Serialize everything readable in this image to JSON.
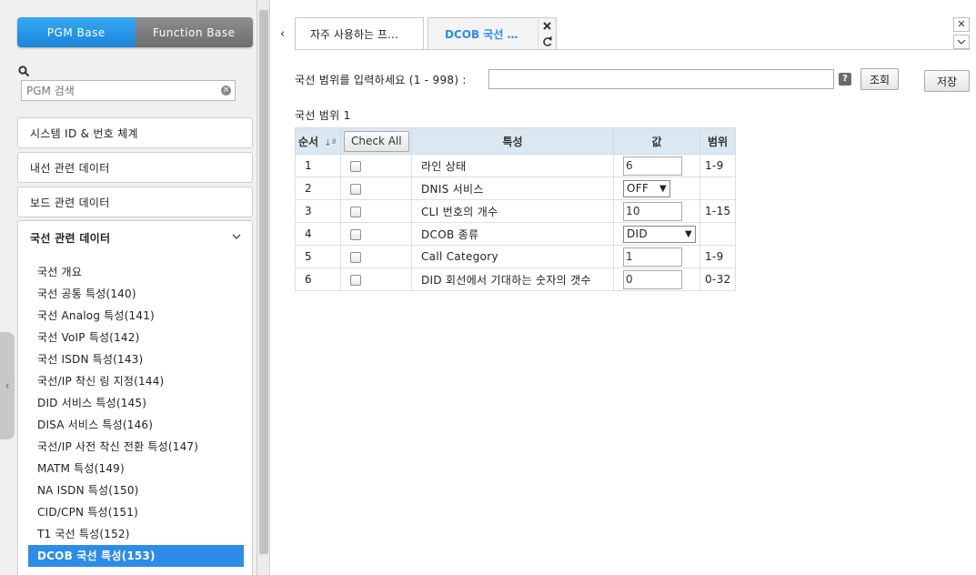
{
  "sidebar": {
    "tabs": [
      "PGM Base",
      "Function Base"
    ],
    "search_placeholder": "PGM 검색",
    "panels": [
      "시스템 ID & 번호 체계",
      "내선 관련 데이터",
      "보드 관련 데이터",
      "국선 관련 데이터"
    ],
    "items": [
      "국선 개요",
      "국선 공통 특성(140)",
      "국선 Analog 특성(141)",
      "국선 VoIP 특성(142)",
      "국선 ISDN 특성(143)",
      "국선/IP 착신 링 지정(144)",
      "DID 서비스 특성(145)",
      "DISA 서비스 특성(146)",
      "국선/IP 사전 착신 전환 특성(147)",
      "MATM 특성(149)",
      "NA ISDN 특성(150)",
      "CID/CPN 특성(151)",
      "T1 국선 특성(152)",
      "DCOB 국선 특성(153)"
    ],
    "active_item": "DCOB 국선 특성(153)"
  },
  "tabs": [
    "자주 사용하는 프…",
    "DCOB 국선 …"
  ],
  "form": {
    "range_label": "국선 범위를 입력하세요 (1 - 998) :",
    "range_value": "",
    "help": "?",
    "search_button": "조회",
    "save_button": "저장",
    "section_title": "국선 범위 1"
  },
  "table": {
    "headers": [
      "순서",
      "Check All",
      "특성",
      "값",
      "범위"
    ],
    "sort_glyph": "↓ª",
    "rows": [
      {
        "no": "1",
        "name": "라인 상태",
        "value": "6",
        "range": "1-9",
        "kind": "input"
      },
      {
        "no": "2",
        "name": "DNIS 서비스",
        "value": "OFF",
        "range": "",
        "kind": "select"
      },
      {
        "no": "3",
        "name": "CLI 번호의 개수",
        "value": "10",
        "range": "1-15",
        "kind": "input"
      },
      {
        "no": "4",
        "name": "DCOB 종류",
        "value": "DID",
        "range": "",
        "kind": "select-wide"
      },
      {
        "no": "5",
        "name": "Call Category",
        "value": "1",
        "range": "1-9",
        "kind": "input"
      },
      {
        "no": "6",
        "name": "DID 회선에서 기대하는 숫자의 갯수",
        "value": "0",
        "range": "0-32",
        "kind": "input"
      }
    ]
  }
}
